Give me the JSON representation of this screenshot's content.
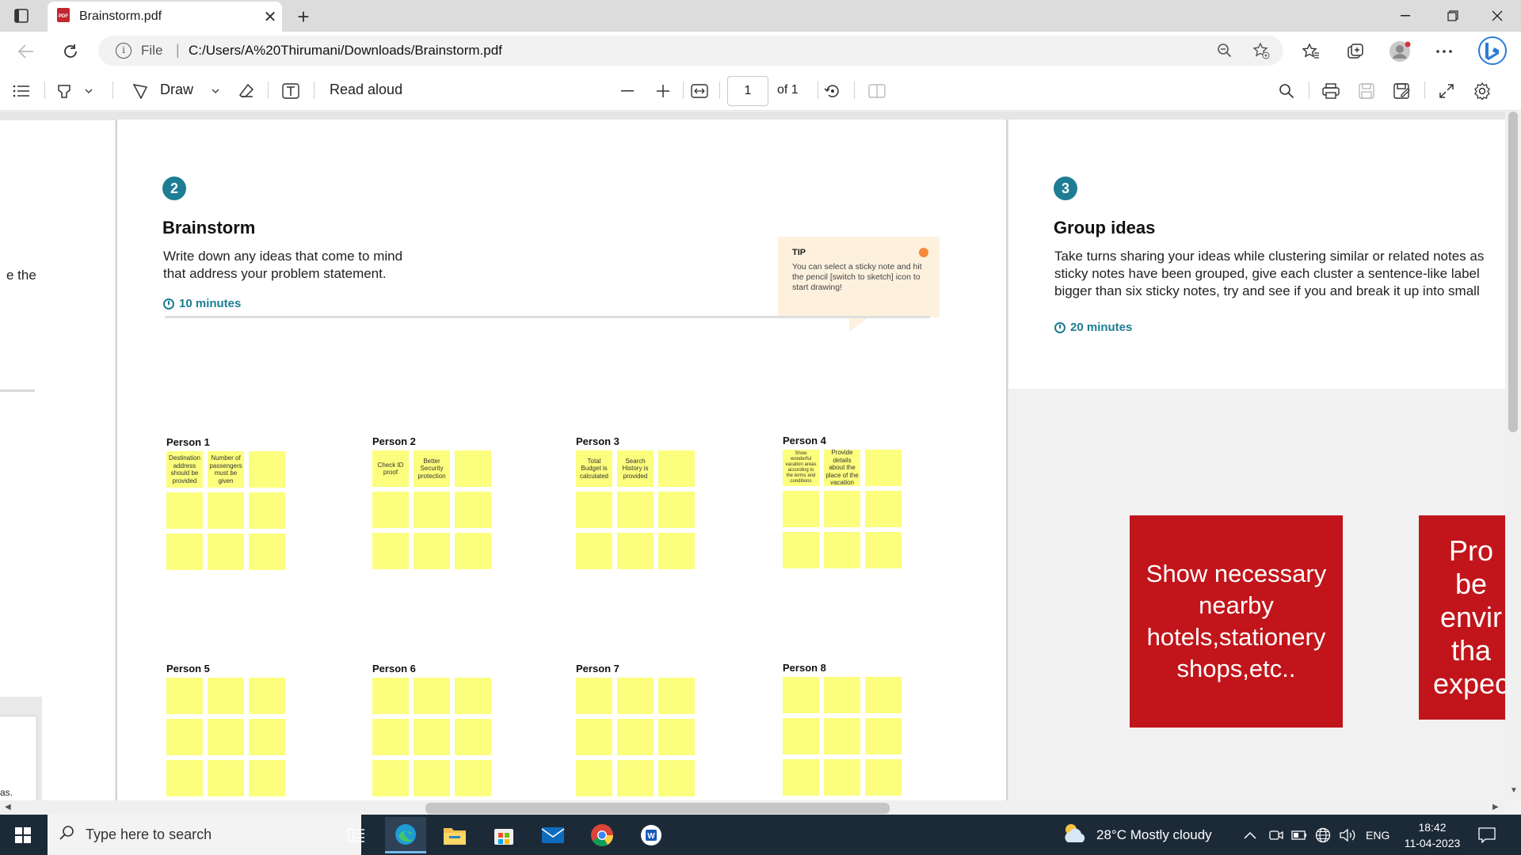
{
  "browser": {
    "tab_title": "Brainstorm.pdf",
    "tab_close": "✕",
    "new_tab": "+",
    "omnibox_file_label": "File",
    "omnibox_sep": "|",
    "url": "C:/Users/A%20Thirumani/Downloads/Brainstorm.pdf"
  },
  "pdf_toolbar": {
    "draw_label": "Draw",
    "read_aloud_label": "Read aloud",
    "page_number": "1",
    "page_total": "of 1"
  },
  "left_page": {
    "fragment_1": "e the",
    "fragment_2": "as."
  },
  "brainstorm": {
    "step_number": "2",
    "title": "Brainstorm",
    "description_line1": "Write down any ideas that come to mind",
    "description_line2": "that address your problem statement.",
    "timer": "10 minutes",
    "tip_title": "TIP",
    "tip_body": "You can select a sticky note and hit the pencil [switch to sketch] icon to start drawing!",
    "persons": [
      {
        "label": "Person 1",
        "notes": [
          "Destination address should be provided",
          "Number of passengers must be given",
          "",
          "",
          "",
          "",
          "",
          "",
          ""
        ]
      },
      {
        "label": "Person 2",
        "notes": [
          "Check ID proof",
          "Better Security protection",
          "",
          "",
          "",
          "",
          "",
          "",
          ""
        ]
      },
      {
        "label": "Person 3",
        "notes": [
          "Total Budget is calculated",
          "Search History is provided",
          "",
          "",
          "",
          "",
          "",
          "",
          ""
        ]
      },
      {
        "label": "Person 4",
        "notes": [
          "Show wonderful vacation areas according to the terms and conditions",
          "Provide details about the place of the vacation",
          "",
          "",
          "",
          "",
          "",
          "",
          ""
        ]
      },
      {
        "label": "Person 5",
        "notes": [
          "",
          "",
          "",
          "",
          "",
          "",
          "",
          "",
          ""
        ]
      },
      {
        "label": "Person 6",
        "notes": [
          "",
          "",
          "",
          "",
          "",
          "",
          "",
          "",
          ""
        ]
      },
      {
        "label": "Person 7",
        "notes": [
          "",
          "",
          "",
          "",
          "",
          "",
          "",
          "",
          ""
        ]
      },
      {
        "label": "Person 8",
        "notes": [
          "",
          "",
          "",
          "",
          "",
          "",
          "",
          "",
          ""
        ]
      }
    ]
  },
  "group_ideas": {
    "step_number": "3",
    "title": "Group ideas",
    "description_line1": "Take turns sharing your ideas while clustering similar or related notes as",
    "description_line2": "sticky notes have been grouped, give each cluster a sentence-like label",
    "description_line3": "bigger than six sticky notes, try and see if you and break it up into small",
    "timer": "20 minutes",
    "card_1": "Show necessary nearby hotels,stationery shops,etc..",
    "card_2_line1": "Pro",
    "card_2_line2": "be",
    "card_2_line3": "envir",
    "card_2_line4": "tha",
    "card_2_line5": "expec"
  },
  "taskbar": {
    "search_placeholder": "Type here to search",
    "weather": "28°C  Mostly cloudy",
    "language": "ENG",
    "time": "18:42",
    "date": "11-04-2023"
  },
  "colors": {
    "teal": "#1d7d93",
    "sticky_yellow": "#fcfe7d",
    "card_red": "#c1151b",
    "taskbar": "#1c2a38"
  }
}
